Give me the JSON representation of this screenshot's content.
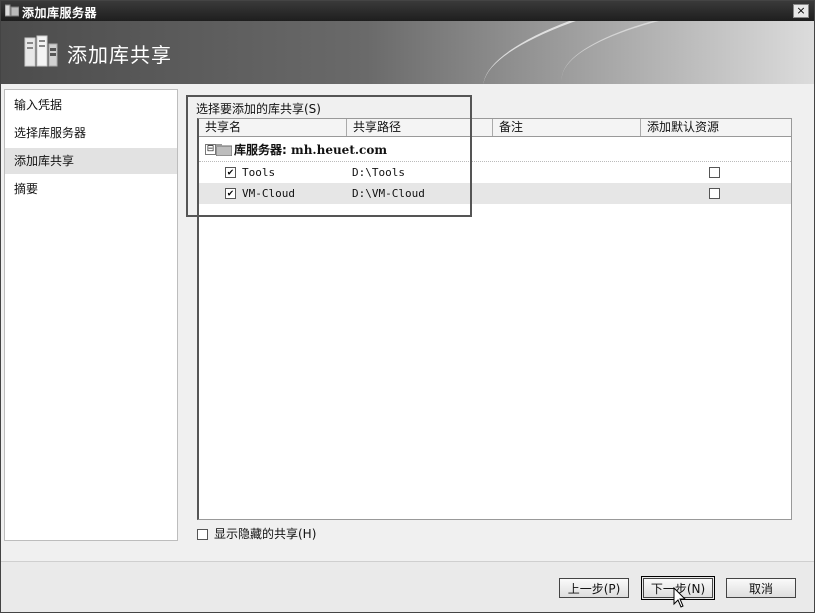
{
  "window": {
    "title": "添加库服务器",
    "close_label": "×"
  },
  "banner": {
    "title": "添加库共享"
  },
  "nav": {
    "items": [
      {
        "label": "输入凭据",
        "active": false
      },
      {
        "label": "选择库服务器",
        "active": false
      },
      {
        "label": "添加库共享",
        "active": true
      },
      {
        "label": "摘要",
        "active": false
      }
    ]
  },
  "shares": {
    "label": "选择要添加的库共享(S)",
    "columns": [
      "共享名",
      "共享路径",
      "备注",
      "添加默认资源"
    ],
    "group": {
      "expander": "⊟",
      "prefix": "库服务器:",
      "server": "mh.heuet.com"
    },
    "rows": [
      {
        "name": "Tools",
        "path": "D:\\Tools",
        "note": "",
        "checked": true,
        "add_default": false,
        "selected": false
      },
      {
        "name": "VM-Cloud",
        "path": "D:\\VM-Cloud",
        "note": "",
        "checked": true,
        "add_default": false,
        "selected": true
      }
    ]
  },
  "show_hidden": {
    "label": "显示隐藏的共享(H)",
    "checked": false
  },
  "buttons": {
    "back": "上一步(P)",
    "next": "下一步(N)",
    "cancel": "取消"
  }
}
